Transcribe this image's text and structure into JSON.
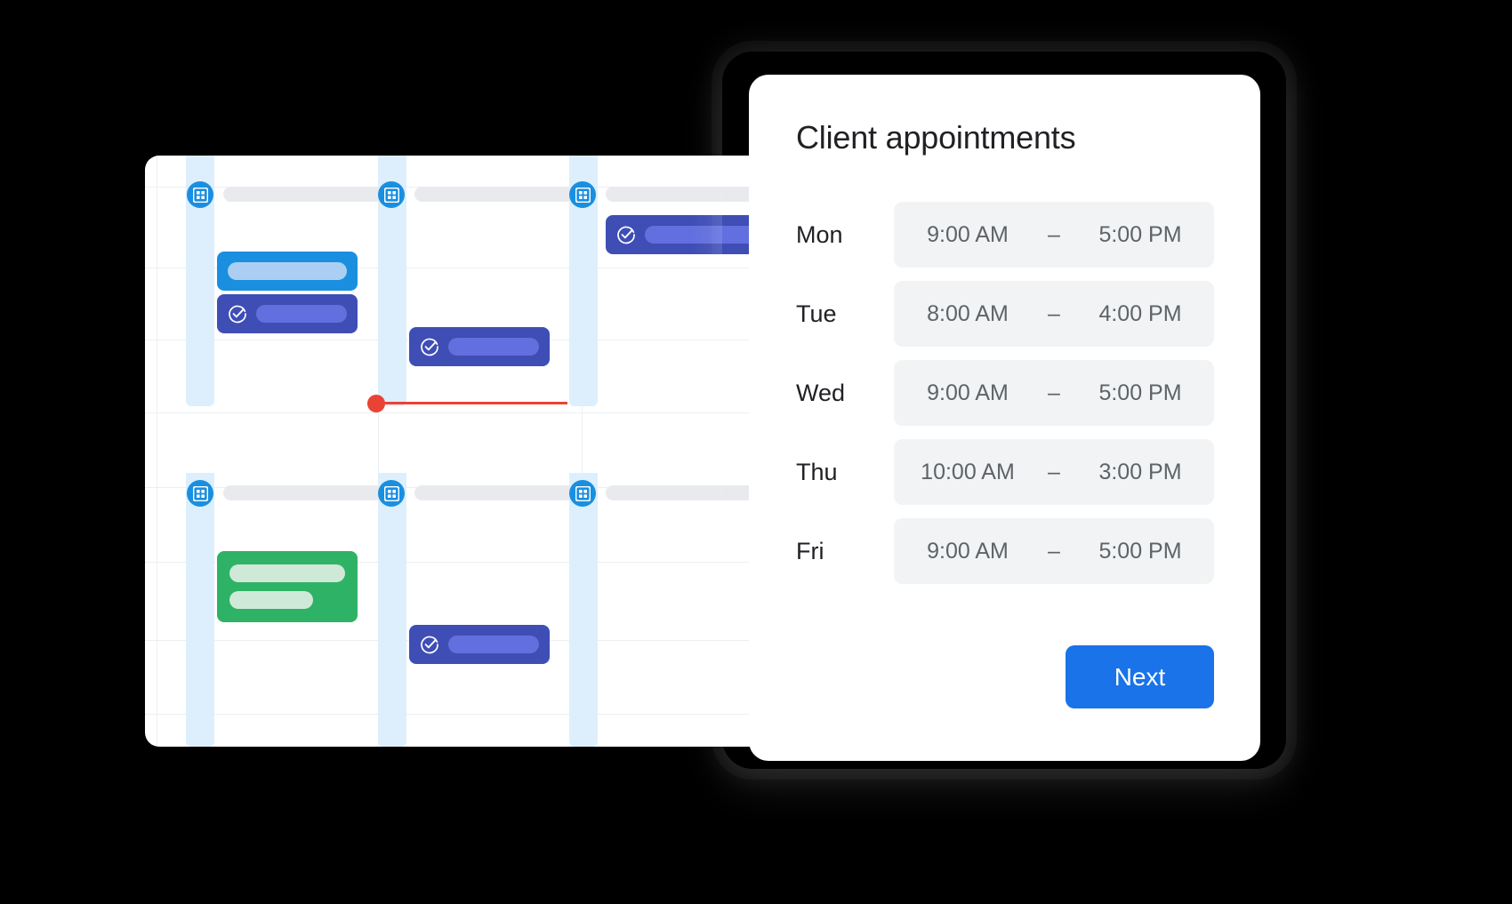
{
  "background_color": "#000000",
  "calendar": {
    "name": "calendar-preview",
    "accent_blue": "#1a8fe0",
    "accent_purple": "#3f4eb5",
    "accent_green": "#2eb265",
    "now_indicator_color": "#ea4335",
    "day_strip_color": "#ddeffc",
    "grid_line_color": "#eceff1",
    "icons": {
      "day_badge": "calendar-grid-icon",
      "event_confirmed": "check-circle-icon"
    },
    "days": [
      {
        "badge": "calendar-grid-icon",
        "title_placeholder": ""
      },
      {
        "badge": "calendar-grid-icon",
        "title_placeholder": ""
      },
      {
        "badge": "calendar-grid-icon",
        "title_placeholder": ""
      },
      {
        "badge": "calendar-grid-icon",
        "title_placeholder": ""
      },
      {
        "badge": "calendar-grid-icon",
        "title_placeholder": ""
      },
      {
        "badge": "calendar-grid-icon",
        "title_placeholder": ""
      }
    ],
    "events": [
      {
        "id": "evt-1",
        "color": "blue",
        "checked": false,
        "label": ""
      },
      {
        "id": "evt-2",
        "color": "purple",
        "checked": true,
        "label": ""
      },
      {
        "id": "evt-3",
        "color": "purple",
        "checked": true,
        "label": ""
      },
      {
        "id": "evt-4",
        "color": "purple",
        "checked": true,
        "label": ""
      },
      {
        "id": "evt-5",
        "color": "green",
        "checked": false,
        "label": ""
      },
      {
        "id": "evt-6",
        "color": "purple",
        "checked": true,
        "label": ""
      }
    ]
  },
  "panel": {
    "title": "Client appointments",
    "dash": "–",
    "schedule": [
      {
        "day": "Mon",
        "start": "9:00 AM",
        "end": "5:00 PM"
      },
      {
        "day": "Tue",
        "start": "8:00 AM",
        "end": "4:00 PM"
      },
      {
        "day": "Wed",
        "start": "9:00 AM",
        "end": "5:00 PM"
      },
      {
        "day": "Thu",
        "start": "10:00 AM",
        "end": "3:00 PM"
      },
      {
        "day": "Fri",
        "start": "9:00 AM",
        "end": "5:00 PM"
      }
    ],
    "next_label": "Next",
    "next_color": "#1a73e8"
  }
}
